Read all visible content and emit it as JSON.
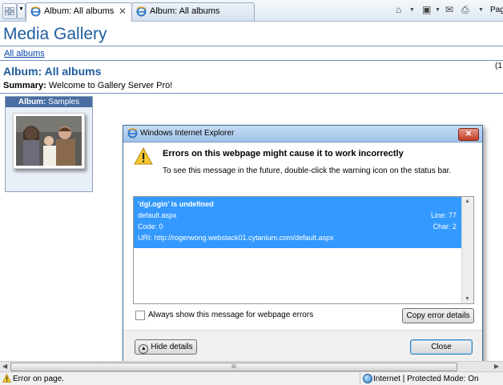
{
  "browser": {
    "tabs": [
      {
        "label": "Album: All albums",
        "active": true
      },
      {
        "label": "Album: All albums",
        "active": false
      }
    ],
    "page_menu_label": "Pag"
  },
  "page": {
    "gallery_title": "Media Gallery",
    "breadcrumb": "All albums",
    "page_indicator": "(1",
    "album_heading": "Album: All albums",
    "summary_label": "Summary:",
    "summary_text": "Welcome to Gallery Server Pro!",
    "thumbnail": {
      "caption_label": "Album:",
      "caption_value": "Samples"
    }
  },
  "dialog": {
    "title": "Windows Internet Explorer",
    "heading": "Errors on this webpage might cause it to work incorrectly",
    "hint": "To see this message in the future, double-click the warning icon on the status bar.",
    "error": {
      "message": "'dgl.ogin' is undefined",
      "file": "default.aspx",
      "line": "Line: 77",
      "code": "Code: 0",
      "char": "Char: 2",
      "uri": "URI: http://rogerwong.webstack01.cytanium.com/default.aspx"
    },
    "checkbox_label": "Always show this message for webpage errors",
    "checkbox_checked": false,
    "copy_button": "Copy error details",
    "hide_button": "Hide details",
    "close_button": "Close"
  },
  "statusbar": {
    "text": "Error on page.",
    "zone": "Internet | Protected Mode: On"
  },
  "colors": {
    "accent": "#1f5d9e",
    "selection": "#3399ff",
    "titlebar": "#9fc2e8"
  }
}
